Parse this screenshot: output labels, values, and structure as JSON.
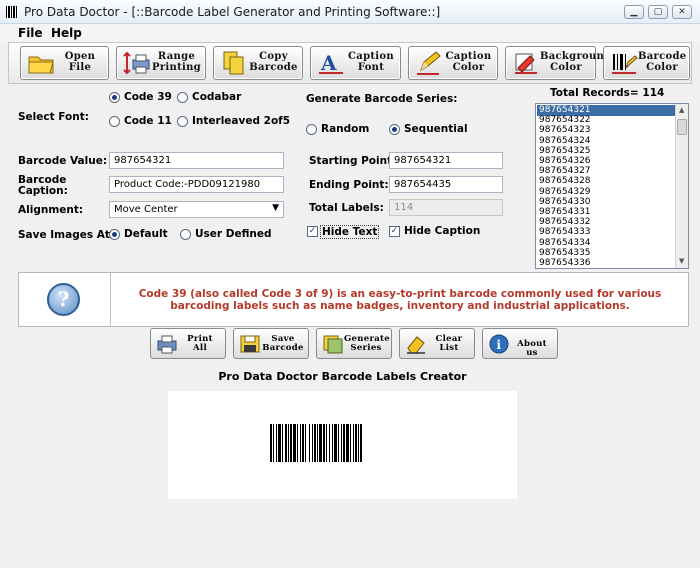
{
  "window": {
    "title": "Pro Data Doctor - [::Barcode Label Generator and Printing Software::]",
    "minimize": "▁",
    "maximize": "▢",
    "close": "✕"
  },
  "menu": [
    "File",
    "Help"
  ],
  "toolbar": [
    {
      "line1": "Open",
      "line2": "File",
      "icon": "folder-icon"
    },
    {
      "line1": "Range",
      "line2": "Printing",
      "icon": "range-printer-icon"
    },
    {
      "line1": "Copy",
      "line2": "Barcode",
      "icon": "copy-icon"
    },
    {
      "line1": "Caption",
      "line2": "Font",
      "icon": "font-icon"
    },
    {
      "line1": "Caption",
      "line2": "Color",
      "icon": "pencil-icon"
    },
    {
      "line1": "Background",
      "line2": "Color",
      "icon": "paint-icon"
    },
    {
      "line1": "Barcode",
      "line2": "Color",
      "icon": "barcode-pencil-icon"
    }
  ],
  "form": {
    "select_font_label": "Select Font:",
    "fonts": [
      {
        "label": "Code 39",
        "selected": true
      },
      {
        "label": "Codabar",
        "selected": false
      },
      {
        "label": "Code 11",
        "selected": false
      },
      {
        "label": "Interleaved 2of5",
        "selected": false
      }
    ],
    "barcode_value_label": "Barcode Value:",
    "barcode_value": "987654321",
    "barcode_caption_label": "Barcode Caption:",
    "barcode_caption": "Product Code:-PDD09121980",
    "alignment_label": "Alignment:",
    "alignment_value": "Move Center",
    "save_images_label": "Save Images At:",
    "save_options": [
      {
        "label": "Default",
        "selected": true
      },
      {
        "label": "User Defined",
        "selected": false
      }
    ]
  },
  "series": {
    "heading": "Generate Barcode Series:",
    "modes": [
      {
        "label": "Random",
        "selected": false
      },
      {
        "label": "Sequential",
        "selected": true
      }
    ],
    "starting_point_label": "Starting Point:",
    "starting_point": "987654321",
    "ending_point_label": "Ending Point:",
    "ending_point": "987654435",
    "total_labels_label": "Total Labels:",
    "total_labels": "114",
    "hide_text_label": "Hide Text",
    "hide_text_checked": true,
    "hide_caption_label": "Hide Caption",
    "hide_caption_checked": true
  },
  "records": {
    "heading": "Total Records= 114",
    "items": [
      "987654321",
      "987654322",
      "987654323",
      "987654324",
      "987654325",
      "987654326",
      "987654327",
      "987654328",
      "987654329",
      "987654330",
      "987654331",
      "987654332",
      "987654333",
      "987654334",
      "987654335",
      "987654336"
    ],
    "selected_index": 0
  },
  "info": {
    "text": "Code 39 (also called Code 3 of 9) is an easy-to-print barcode commonly used for various barcoding labels such as name badges, inventory and industrial applications.",
    "icon": "help-icon"
  },
  "actions": [
    {
      "line1": "Print",
      "line2": "All",
      "icon": "printer-icon"
    },
    {
      "line1": "Save",
      "line2": "Barcode",
      "icon": "save-icon"
    },
    {
      "line1": "Generate",
      "line2": "Series",
      "icon": "generate-icon"
    },
    {
      "line1": "Clear",
      "line2": "List",
      "icon": "eraser-icon"
    },
    {
      "line1": "About us",
      "line2": "",
      "icon": "info-icon"
    }
  ],
  "preview": {
    "title": "Pro Data Doctor Barcode Labels Creator"
  },
  "colors": {
    "info_text": "#b33a2a",
    "list_selection": "#3a6ea5"
  }
}
